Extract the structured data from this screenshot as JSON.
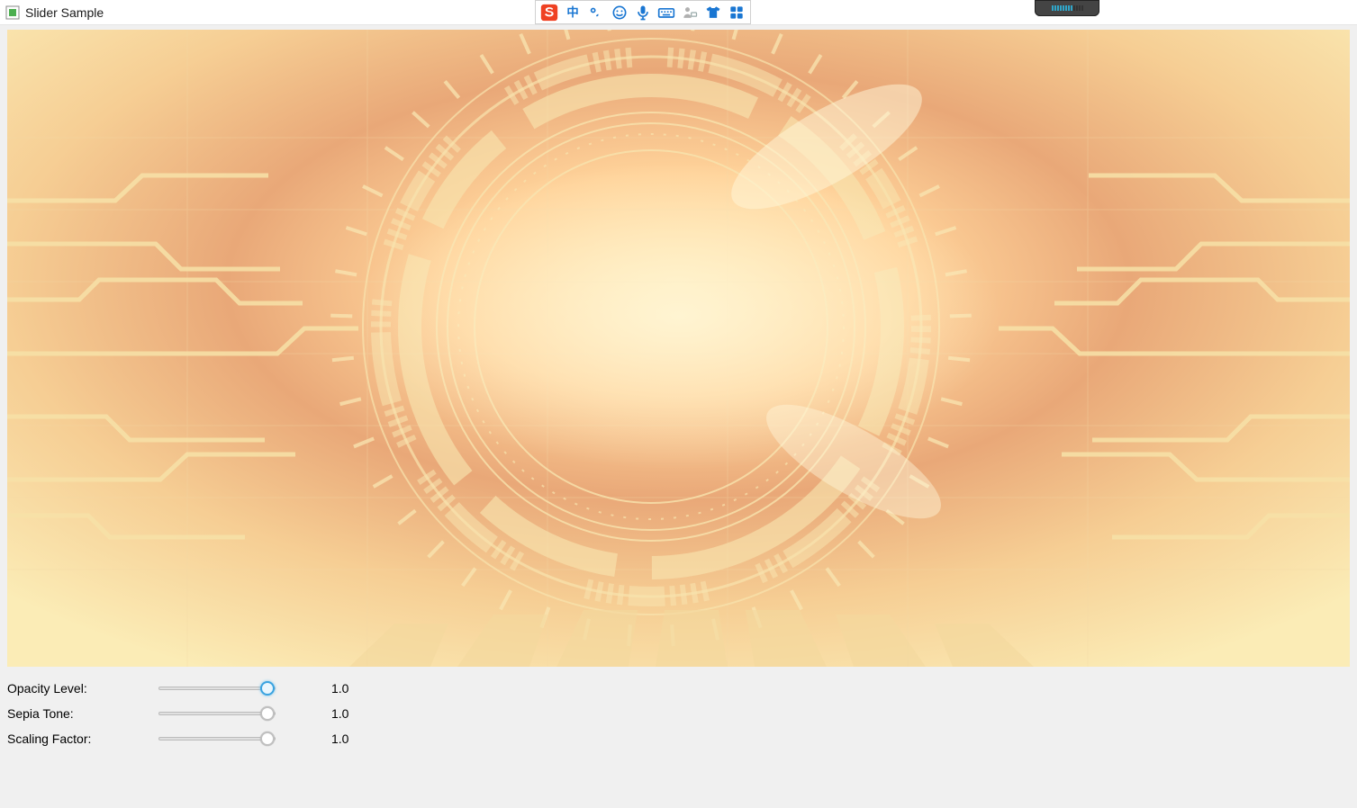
{
  "window": {
    "title": "Slider Sample"
  },
  "ime": {
    "icons": [
      "sogou-s-icon",
      "chinese-zhong-icon",
      "char-degree-icon",
      "emoji-icon",
      "microphone-icon",
      "keyboard-icon",
      "person-icon",
      "shirt-icon",
      "grid-icon"
    ]
  },
  "controls": [
    {
      "label": "Opacity Level:",
      "value": "1.0",
      "position": 1.0,
      "active": true
    },
    {
      "label": "Sepia Tone:",
      "value": "1.0",
      "position": 1.0,
      "active": false
    },
    {
      "label": "Scaling Factor:",
      "value": "1.0",
      "position": 1.0,
      "active": false
    }
  ]
}
